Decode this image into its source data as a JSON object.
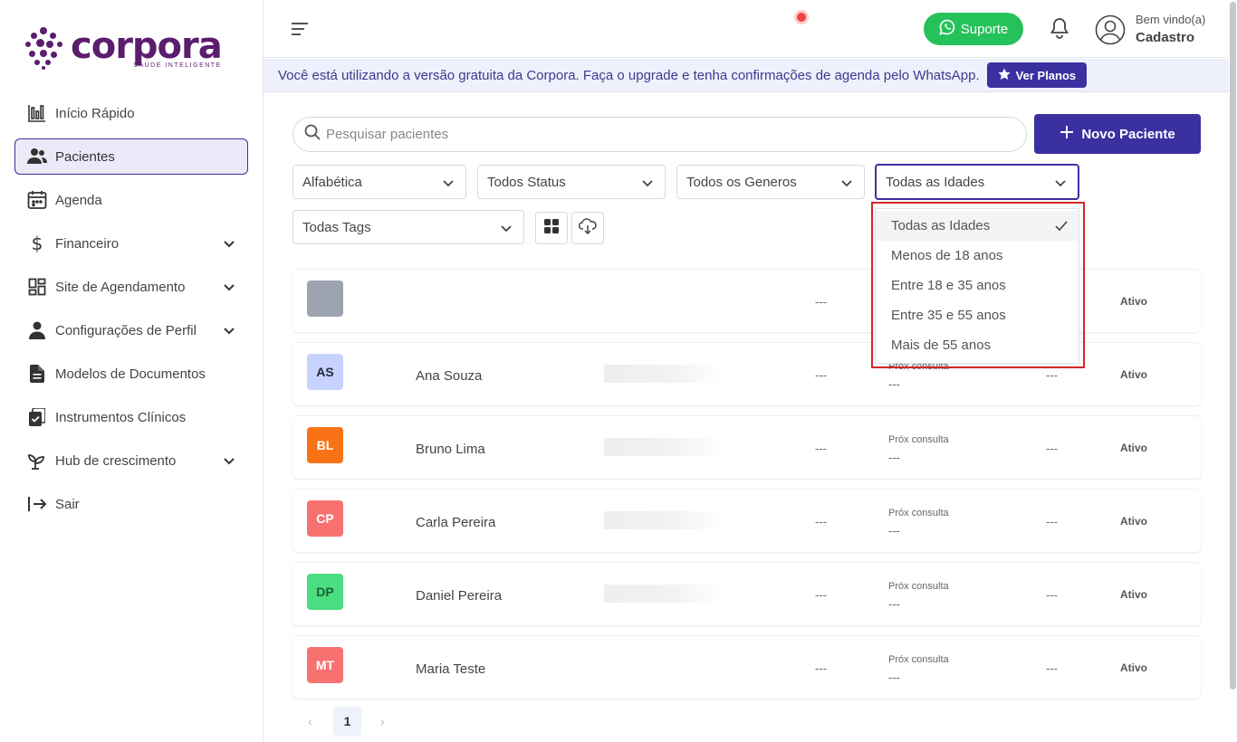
{
  "brand": {
    "name": "corpora",
    "tagline": "SAÚDE INTELIGENTE",
    "color": "#5b1d6e"
  },
  "sidebar": {
    "items": [
      {
        "label": "Início Rápido",
        "icon": "chart-bar-icon",
        "has_chevron": false
      },
      {
        "label": "Pacientes",
        "icon": "users-icon",
        "active": true,
        "has_chevron": false
      },
      {
        "label": "Agenda",
        "icon": "calendar-icon",
        "has_chevron": false
      },
      {
        "label": "Financeiro",
        "icon": "dollar-icon",
        "has_chevron": true
      },
      {
        "label": "Site de Agendamento",
        "icon": "layout-grid-icon",
        "has_chevron": true
      },
      {
        "label": "Configurações de Perfil",
        "icon": "user-icon",
        "has_chevron": true
      },
      {
        "label": "Modelos de Documentos",
        "icon": "document-icon",
        "has_chevron": false
      },
      {
        "label": "Instrumentos Clínicos",
        "icon": "clipboard-icon",
        "has_chevron": false
      },
      {
        "label": "Hub de crescimento",
        "icon": "sprout-icon",
        "has_chevron": true
      },
      {
        "label": "Sair",
        "icon": "logout-icon",
        "has_chevron": false
      }
    ]
  },
  "header": {
    "support_label": "Suporte",
    "welcome": "Bem vindo(a)",
    "username": "Cadastro"
  },
  "banner": {
    "text": "Você está utilizando a versão gratuita da Corpora. Faça o upgrade e tenha confirmações de agenda pelo WhatsApp.",
    "button": "Ver Planos"
  },
  "search": {
    "placeholder": "Pesquisar pacientes"
  },
  "new_patient_label": "Novo Paciente",
  "filters": {
    "order": "Alfabética",
    "status": "Todos Status",
    "gender": "Todos os Generos",
    "age": "Todas as Idades",
    "tags": "Todas Tags"
  },
  "age_dropdown": {
    "options": [
      "Todas as Idades",
      "Menos de 18 anos",
      "Entre 18 e 35 anos",
      "Entre 35 e 55 anos",
      "Mais de 55 anos"
    ],
    "selected": "Todas as Idades"
  },
  "patients": [
    {
      "initials": "",
      "name": "",
      "avatar_bg": "#9ca3af",
      "avatar_fg": "#ffffff",
      "col3": "---",
      "next_label": "",
      "next_value": "",
      "col5": "",
      "status": "Ativo"
    },
    {
      "initials": "AS",
      "name": "Ana Souza",
      "avatar_bg": "#c7d2fe",
      "avatar_fg": "#1f2937",
      "col3": "---",
      "next_label": "Próx consulta",
      "next_value": "---",
      "col5": "---",
      "status": "Ativo"
    },
    {
      "initials": "BL",
      "name": "Bruno Lima",
      "avatar_bg": "#f97316",
      "avatar_fg": "#ffffff",
      "col3": "---",
      "next_label": "Próx consulta",
      "next_value": "---",
      "col5": "---",
      "status": "Ativo"
    },
    {
      "initials": "CP",
      "name": "Carla Pereira",
      "avatar_bg": "#f87171",
      "avatar_fg": "#ffffff",
      "col3": "---",
      "next_label": "Próx consulta",
      "next_value": "---",
      "col5": "---",
      "status": "Ativo"
    },
    {
      "initials": "DP",
      "name": "Daniel Pereira",
      "avatar_bg": "#4ade80",
      "avatar_fg": "#166534",
      "col3": "---",
      "next_label": "Próx consulta",
      "next_value": "---",
      "col5": "---",
      "status": "Ativo"
    },
    {
      "initials": "MT",
      "name": "Maria Teste",
      "avatar_bg": "#f87171",
      "avatar_fg": "#ffffff",
      "col3": "---",
      "next_label": "Próx consulta",
      "next_value": "---",
      "col5": "---",
      "status": "Ativo"
    }
  ],
  "pagination": {
    "prev": "‹",
    "current": "1",
    "next": "›"
  },
  "colors": {
    "primary": "#3b30a0",
    "whatsapp": "#25c15b",
    "highlight": "#d32626"
  }
}
